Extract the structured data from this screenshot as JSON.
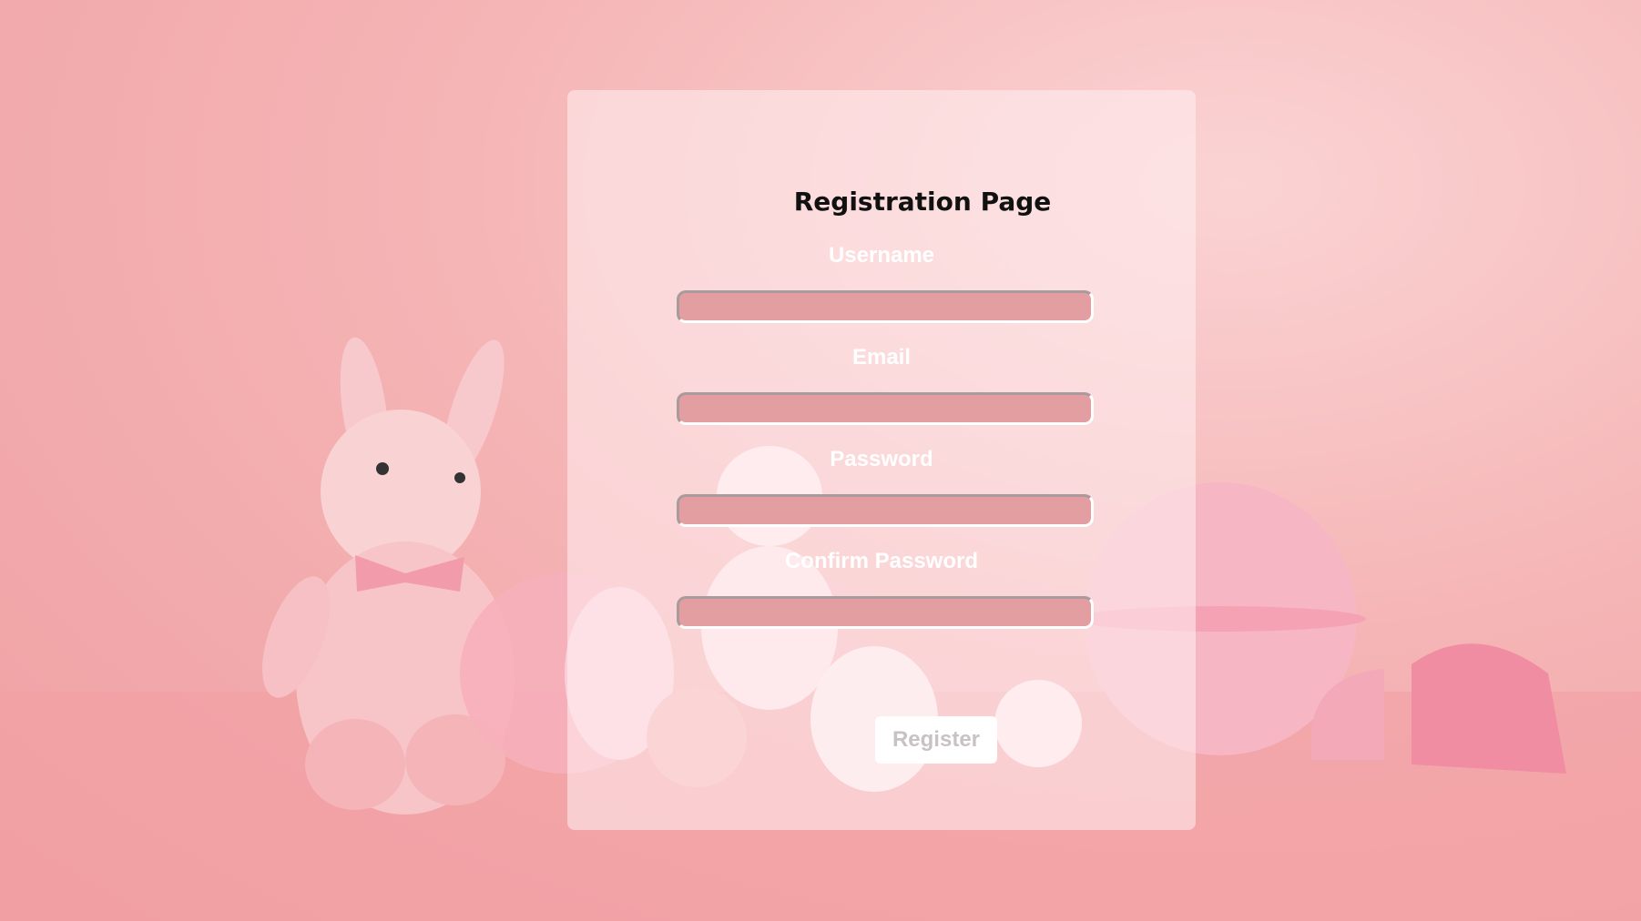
{
  "page": {
    "title": "Registration Page"
  },
  "form": {
    "fields": [
      {
        "label": "Username",
        "value": ""
      },
      {
        "label": "Email",
        "value": ""
      },
      {
        "label": "Password",
        "value": ""
      },
      {
        "label": "Confirm Password",
        "value": ""
      }
    ],
    "submit_label": "Register"
  },
  "colors": {
    "background": "#f5b4b5",
    "input_fill": "#e39ea1",
    "card_overlay": "rgba(255,240,242,0.55)",
    "title_text": "#111111",
    "label_text": "#ffffff"
  }
}
